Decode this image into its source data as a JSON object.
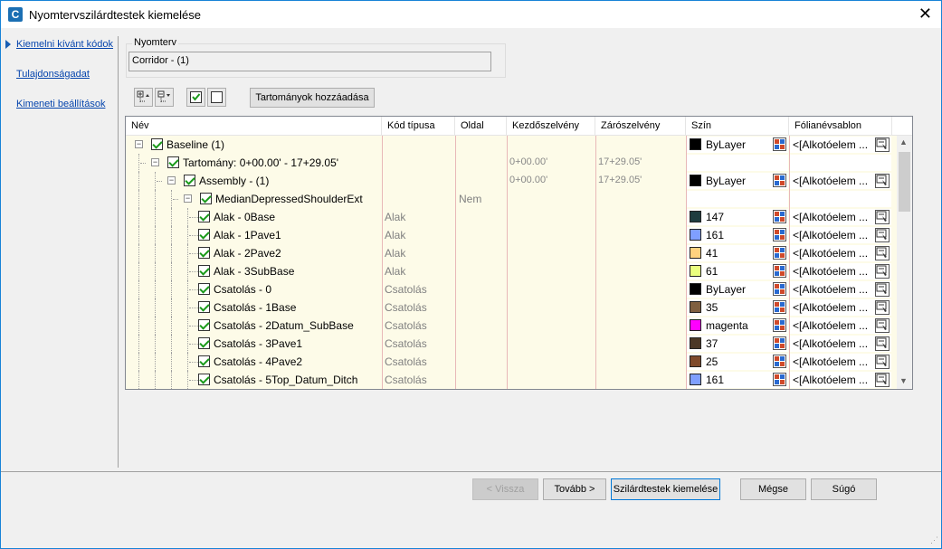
{
  "window": {
    "title": "Nyomtervszilárdtestek kiemelése",
    "icon_letter": "C"
  },
  "nav": {
    "items": [
      "Kiemelni kívánt kódok",
      "Tulajdonságadat",
      "Kimeneti beállítások"
    ]
  },
  "group": {
    "label": "Nyomterv",
    "value": "Corridor - (1)"
  },
  "toolbar": {
    "add_ranges": "Tartományok hozzáadása"
  },
  "grid": {
    "columns": [
      "Név",
      "Kód típusa",
      "Oldal",
      "Kezdőszelvény",
      "Zárószelvény",
      "Szín",
      "Fólianévsablon"
    ],
    "rows": [
      {
        "name": "Baseline (1)",
        "type": "",
        "side": "",
        "start": "",
        "end": "",
        "color": "ByLayer",
        "swatch": "#000000",
        "layer": "<[Alkotóelem ..."
      },
      {
        "name": "Tartomány: 0+00.00' - 17+29.05'",
        "type": "",
        "side": "",
        "start": "0+00.00'",
        "end": "17+29.05'",
        "color": "",
        "swatch": "",
        "layer": ""
      },
      {
        "name": "Assembly - (1)",
        "type": "",
        "side": "",
        "start": "0+00.00'",
        "end": "17+29.05'",
        "color": "ByLayer",
        "swatch": "#000000",
        "layer": "<[Alkotóelem ..."
      },
      {
        "name": "MedianDepressedShoulderExt",
        "type": "",
        "side": "Nem",
        "start": "",
        "end": "",
        "color": "",
        "swatch": "",
        "layer": ""
      },
      {
        "name": "Alak - 0Base",
        "type": "Alak",
        "side": "",
        "start": "",
        "end": "",
        "color": "147",
        "swatch": "#1f3d3f",
        "layer": "<[Alkotóelem ..."
      },
      {
        "name": "Alak - 1Pave1",
        "type": "Alak",
        "side": "",
        "start": "",
        "end": "",
        "color": "161",
        "swatch": "#7f9fff",
        "layer": "<[Alkotóelem ..."
      },
      {
        "name": "Alak - 2Pave2",
        "type": "Alak",
        "side": "",
        "start": "",
        "end": "",
        "color": "41",
        "swatch": "#ffd27f",
        "layer": "<[Alkotóelem ..."
      },
      {
        "name": "Alak - 3SubBase",
        "type": "Alak",
        "side": "",
        "start": "",
        "end": "",
        "color": "61",
        "swatch": "#eaff7f",
        "layer": "<[Alkotóelem ..."
      },
      {
        "name": "Csatolás - 0",
        "type": "Csatolás",
        "side": "",
        "start": "",
        "end": "",
        "color": "ByLayer",
        "swatch": "#000000",
        "layer": "<[Alkotóelem ..."
      },
      {
        "name": "Csatolás - 1Base",
        "type": "Csatolás",
        "side": "",
        "start": "",
        "end": "",
        "color": "35",
        "swatch": "#7f5f3f",
        "layer": "<[Alkotóelem ..."
      },
      {
        "name": "Csatolás - 2Datum_SubBase",
        "type": "Csatolás",
        "side": "",
        "start": "",
        "end": "",
        "color": "magenta",
        "swatch": "#ff00ff",
        "layer": "<[Alkotóelem ..."
      },
      {
        "name": "Csatolás - 3Pave1",
        "type": "Csatolás",
        "side": "",
        "start": "",
        "end": "",
        "color": "37",
        "swatch": "#4c3826",
        "layer": "<[Alkotóelem ..."
      },
      {
        "name": "Csatolás - 4Pave2",
        "type": "Csatolás",
        "side": "",
        "start": "",
        "end": "",
        "color": "25",
        "swatch": "#7f4a2b",
        "layer": "<[Alkotóelem ..."
      },
      {
        "name": "Csatolás - 5Top_Datum_Ditch",
        "type": "Csatolás",
        "side": "",
        "start": "",
        "end": "",
        "color": "161",
        "swatch": "#7f9fff",
        "layer": "<[Alkotóelem ..."
      }
    ]
  },
  "footer": {
    "back": "< Vissza",
    "next": "Tovább >",
    "extract": "Szilárdtestek kiemelése",
    "cancel": "Mégse",
    "help": "Súgó"
  }
}
